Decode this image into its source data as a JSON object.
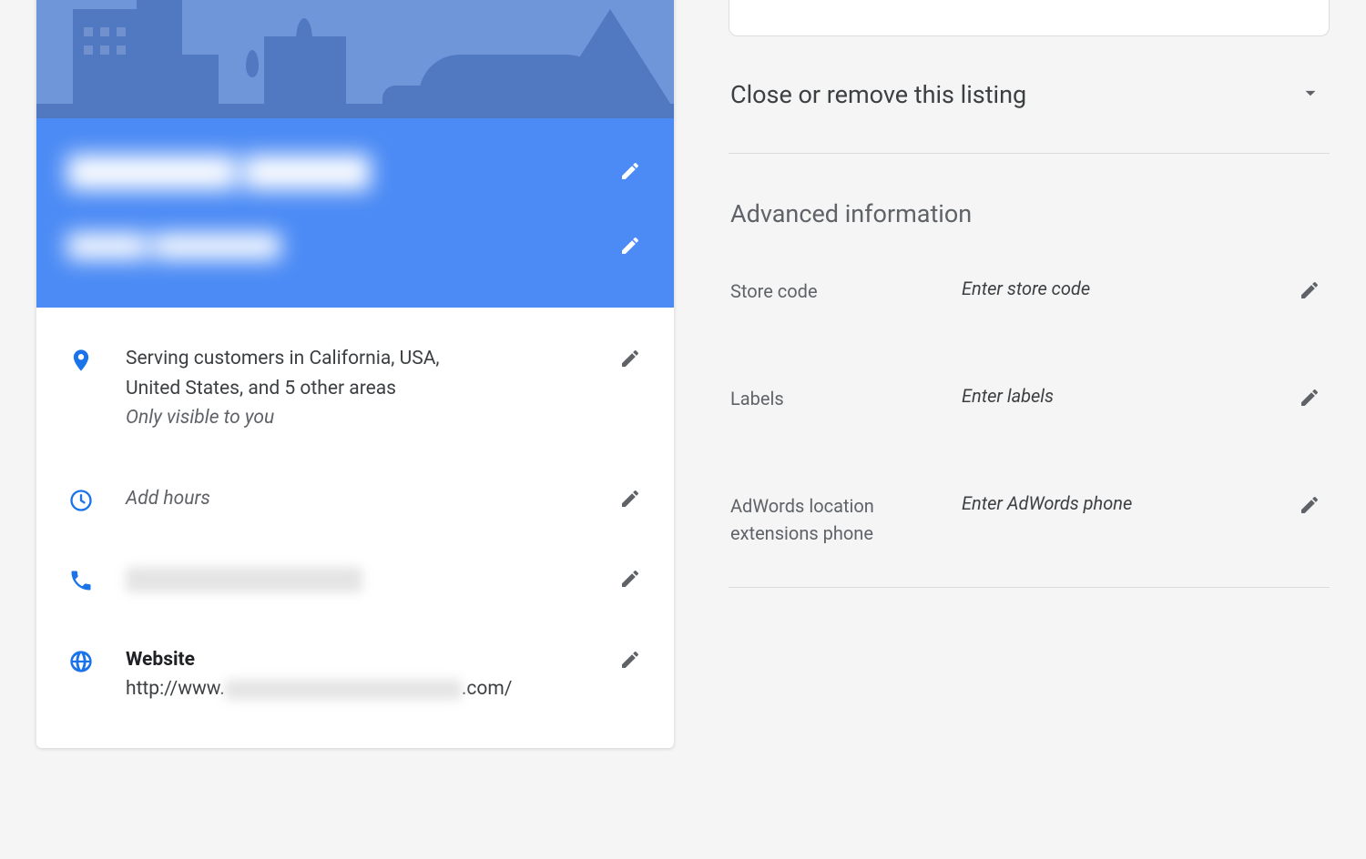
{
  "colors": {
    "accent": "#4285f4",
    "muted": "#5f6368"
  },
  "card": {
    "title": "████████  ██████",
    "subtitle": "█████ ████████",
    "rows": {
      "location": {
        "line1": "Serving customers in California, USA,",
        "line2": "United States, and 5 other areas",
        "note": "Only visible to you"
      },
      "hours": {
        "placeholder": "Add hours"
      },
      "phone": {
        "value": "███ █████"
      },
      "website": {
        "label": "Website",
        "url_prefix": "http://www.",
        "url_suffix": ".com/"
      }
    }
  },
  "right": {
    "close_heading": "Close or remove this listing",
    "advanced_heading": "Advanced information",
    "fields": {
      "store_code": {
        "label": "Store code",
        "placeholder": "Enter store code"
      },
      "labels": {
        "label": "Labels",
        "placeholder": "Enter labels"
      },
      "adwords": {
        "label": "AdWords location extensions phone",
        "placeholder": "Enter AdWords phone"
      }
    }
  }
}
